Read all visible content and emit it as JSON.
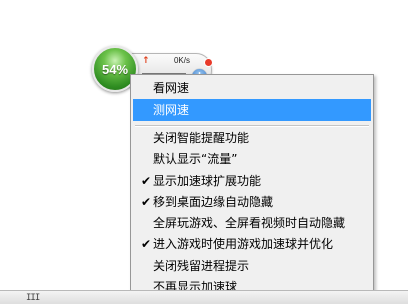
{
  "widget": {
    "percent": "54%",
    "upload_arrow": "↑",
    "upload_speed": "0K/s",
    "plus_label": "+"
  },
  "menu": {
    "items": [
      {
        "label": "看网速",
        "checked": false,
        "highlighted": false
      },
      {
        "label": "测网速",
        "checked": false,
        "highlighted": true
      },
      {
        "label": "关闭智能提醒功能",
        "checked": false,
        "highlighted": false
      },
      {
        "label": "默认显示“流量”",
        "checked": false,
        "highlighted": false
      },
      {
        "label": "显示加速球扩展功能",
        "checked": true,
        "highlighted": false
      },
      {
        "label": "移到桌面边缘自动隐藏",
        "checked": true,
        "highlighted": false
      },
      {
        "label": "全屏玩游戏、全屏看视频时自动隐藏",
        "checked": false,
        "highlighted": false
      },
      {
        "label": "进入游戏时使用游戏加速球并优化",
        "checked": true,
        "highlighted": false
      },
      {
        "label": "关闭残留进程提示",
        "checked": false,
        "highlighted": false
      },
      {
        "label": "不再显示加速球",
        "checked": false,
        "highlighted": false
      }
    ],
    "check_mark": "✔"
  },
  "bottom_bar": {
    "grip": "III"
  },
  "colors": {
    "highlight": "#3399ff",
    "ball_green": "#4aa934",
    "menu_bg": "#f0f0f0"
  }
}
